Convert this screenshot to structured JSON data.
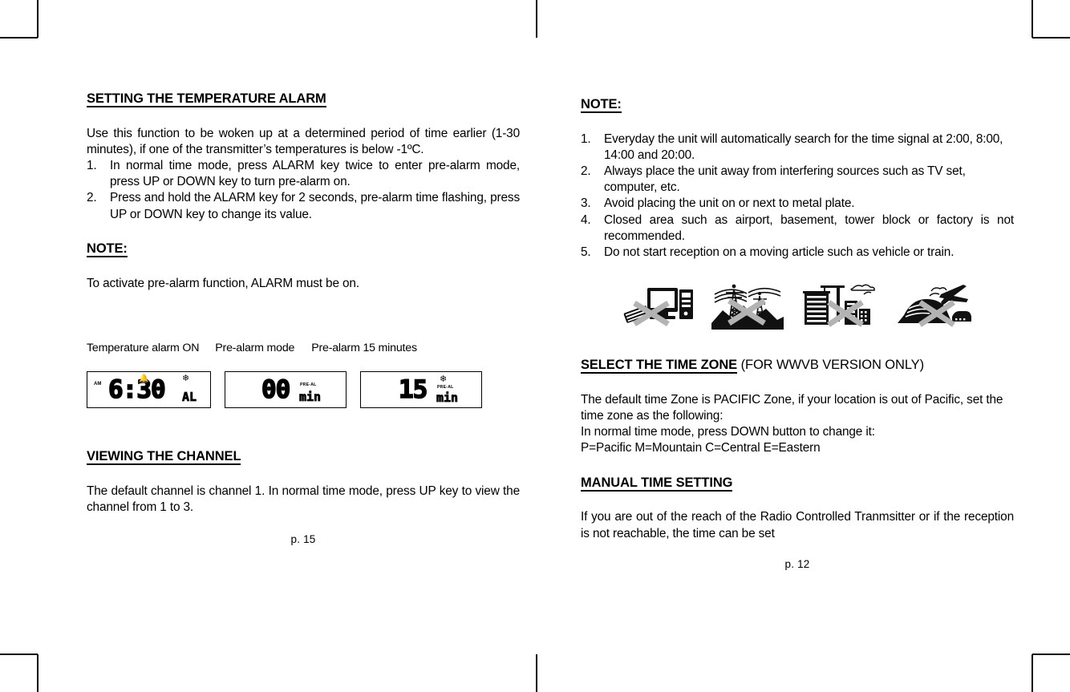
{
  "document": {
    "kind": "instruction-manual-spread",
    "left_page_number": "p. 15",
    "right_page_number": "p. 12"
  },
  "left_page": {
    "heading_1": "SETTING THE TEMPERATURE ALARM",
    "intro": "Use this function to be woken up at a determined period of time earlier (1-30 minutes), if one of the transmitter’s temperatures is below -1ºC.",
    "steps": [
      {
        "num": "1.",
        "text": "In normal time mode, press ALARM key twice to enter pre-alarm mode, press UP or DOWN key to turn pre-alarm on."
      },
      {
        "num": "2.",
        "text": "Press and hold the ALARM key for 2 seconds, pre-alarm time flashing, press UP or DOWN key to change its value."
      }
    ],
    "note_heading": "NOTE:",
    "note_text": "To activate pre-alarm function, ALARM must be on.",
    "lcd_captions": [
      "Temperature alarm ON",
      "Pre-alarm mode",
      "Pre-alarm 15 minutes"
    ],
    "lcd_panels": [
      {
        "name": "temperature-alarm-on",
        "am_pm": "AM",
        "digits": "6:30",
        "suffix": "AL",
        "bell_icon": "bell-icon",
        "snowflake_icon": "snowflake-icon"
      },
      {
        "name": "pre-alarm-mode",
        "digits": "00",
        "label": "PRE-AL",
        "unit": "min"
      },
      {
        "name": "pre-alarm-15-minutes",
        "digits": "15",
        "label": "PRE-AL",
        "unit": "min",
        "snowflake_icon": "snowflake-icon"
      }
    ],
    "heading_2": "VIEWING THE CHANNEL",
    "channel_text": "The default channel is channel 1. In normal time mode, press UP key to view the channel from 1 to 3."
  },
  "right_page": {
    "note_heading": "NOTE:",
    "notes": [
      {
        "num": "1.",
        "text": "Everyday the unit will automatically search for the time signal at 2:00, 8:00, 14:00 and 20:00."
      },
      {
        "num": "2.",
        "text": " Always place the unit away from interfering sources such as TV set, computer, etc."
      },
      {
        "num": "3.",
        "text": " Avoid placing the unit on or next to metal plate."
      },
      {
        "num": "4.",
        "text": "Closed area such as airport, basement, tower block or factory is not recommended."
      },
      {
        "num": "5.",
        "text": "Do not start reception on a moving article such as vehicle or train."
      }
    ],
    "pictograms": [
      {
        "name": "tv-computer-prohibited-icon",
        "caption": ""
      },
      {
        "name": "power-lines-prohibited-icon",
        "caption": ""
      },
      {
        "name": "buildings-construction-prohibited-icon",
        "caption": ""
      },
      {
        "name": "airport-aircraft-prohibited-icon",
        "caption": ""
      }
    ],
    "heading_timezone": "SELECT THE  TIME ZONE",
    "heading_timezone_suffix": " (FOR WWVB VERSION ONLY)",
    "timezone_para_1": "The default time Zone is PACIFIC Zone, if  your location is out of Pacific, set the time zone as the following:",
    "timezone_para_2": "In normal time mode, press DOWN button to change it:",
    "timezone_legend": "P=Pacific   M=Mountain   C=Central   E=Eastern",
    "heading_manual": "MANUAL TIME SETTING",
    "manual_text": "If you are out of the reach of the Radio Controlled Tranmsitter or if the reception is not reachable, the time can be set"
  },
  "colors": {
    "ink": "#000000",
    "paper": "#ffffff",
    "picto_cross": "#b3b3b3"
  }
}
